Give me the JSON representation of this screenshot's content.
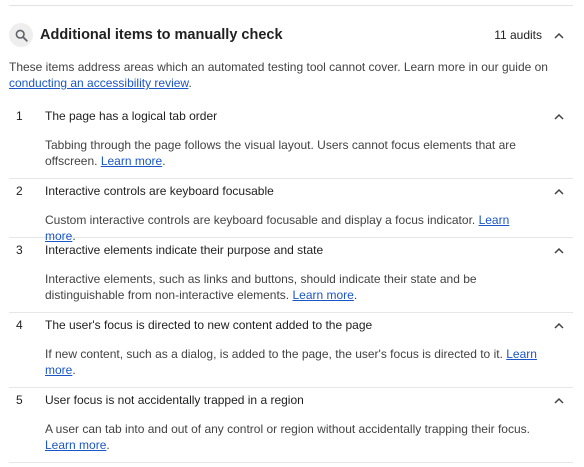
{
  "group": {
    "title": "Additional items to manually check",
    "audit_count": "11 audits",
    "description": "These items address areas which an automated testing tool cannot cover. Learn more in our guide on ",
    "description_link": "conducting an accessibility review",
    "description_end": "."
  },
  "audits": [
    {
      "number": "1",
      "title": "The page has a logical tab order",
      "description": "Tabbing through the page follows the visual layout. Users cannot focus elements that are offscreen. ",
      "link": "Learn more",
      "end": "."
    },
    {
      "number": "2",
      "title": "Interactive controls are keyboard focusable",
      "description": "Custom interactive controls are keyboard focusable and display a focus indicator. ",
      "link": "Learn more",
      "end": "."
    },
    {
      "number": "3",
      "title": "Interactive elements indicate their purpose and state",
      "description": "Interactive elements, such as links and buttons, should indicate their state and be distinguishable from non-interactive elements. ",
      "link": "Learn more",
      "end": "."
    },
    {
      "number": "4",
      "title": "The user's focus is directed to new content added to the page",
      "description": "If new content, such as a dialog, is added to the page, the user's focus is directed to it. ",
      "link": "Learn more",
      "end": "."
    },
    {
      "number": "5",
      "title": "User focus is not accidentally trapped in a region",
      "description": "A user can tab into and out of any control or region without accidentally trapping their focus. ",
      "link": "Learn more",
      "end": "."
    }
  ],
  "colors": {
    "link": "#1a56c6",
    "text": "#212121",
    "divider": "#e6e6e6"
  },
  "icons": {
    "group": "search-icon",
    "toggle": "chevron-up-icon"
  }
}
